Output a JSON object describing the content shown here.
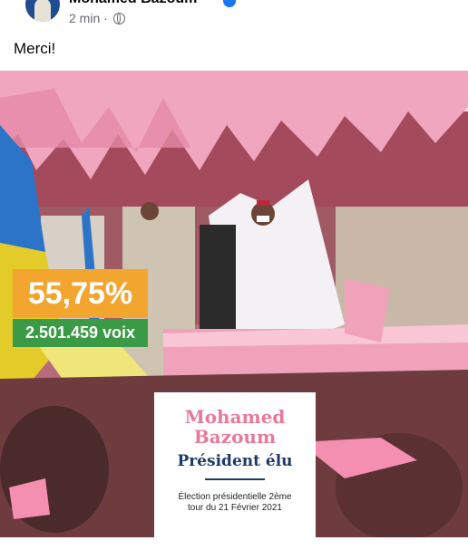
{
  "post": {
    "author": "Mohamed Bazoum",
    "time": "2 min",
    "separator": "·",
    "text": "Merci!",
    "privacy_icon": "globe-icon",
    "verified_icon": "verified-badge-icon"
  },
  "image": {
    "percentage": "55,75%",
    "votes": "2.501.459 voix",
    "card": {
      "name_line1": "Mohamed",
      "name_line2": "Bazoum",
      "title": "Président élu",
      "subtitle_line1": "Élection présidentielle 2ème",
      "subtitle_line2": "tour du 21 Février 2021"
    },
    "colors": {
      "percentage_bg": "#f2a630",
      "votes_bg": "#3a9a45",
      "name_color": "#e8799a",
      "title_color": "#1d3a66"
    }
  }
}
